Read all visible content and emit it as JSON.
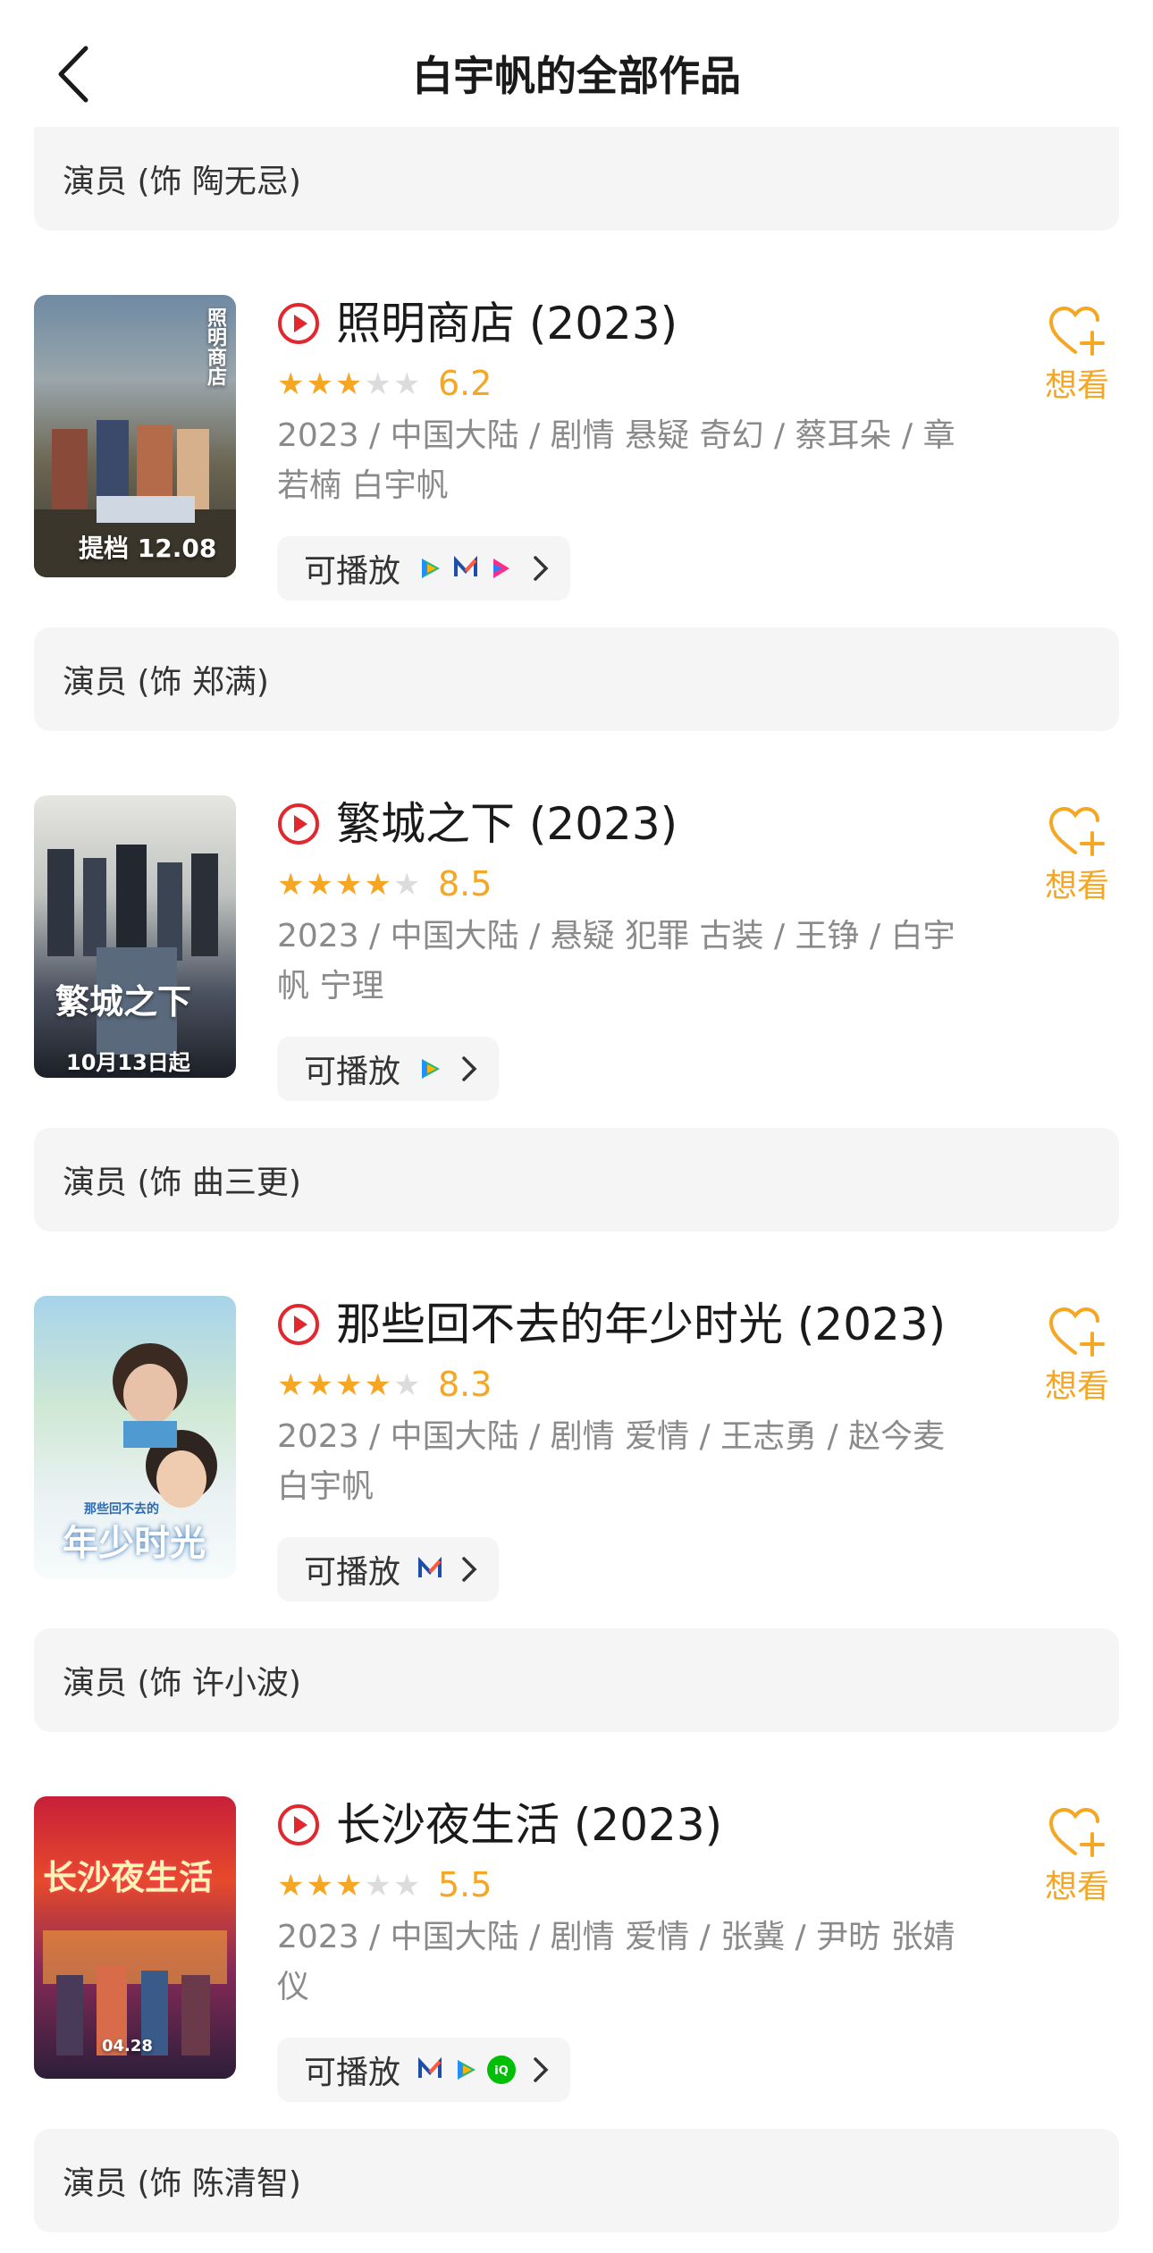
{
  "header": {
    "title": "白宇帆的全部作品"
  },
  "roles": [
    "演员 (饰 陶无忌)",
    "演员 (饰 郑满)",
    "演员 (饰 曲三更)",
    "演员 (饰 许小波)",
    "演员 (饰 陈清智)"
  ],
  "works": [
    {
      "title": "照明商店 (2023)",
      "rating": "6.2",
      "stars": 3,
      "meta": "2023 / 中国大陆 / 剧情 悬疑 奇幻 / 蔡耳朵 / 章若楠 白宇帆",
      "play_label": "可播放",
      "platforms": [
        "tencent-video-icon",
        "mgtv-icon",
        "youku-icon"
      ],
      "want_label": "想看",
      "poster_text": [
        "照明商店",
        "提档 12.08"
      ]
    },
    {
      "title": "繁城之下 (2023)",
      "rating": "8.5",
      "stars": 4,
      "meta": "2023 / 中国大陆 / 悬疑 犯罪 古装 / 王铮 / 白宇帆 宁理",
      "play_label": "可播放",
      "platforms": [
        "tencent-video-icon"
      ],
      "want_label": "想看",
      "poster_text": [
        "繁城之下",
        "10月13日起"
      ]
    },
    {
      "title": "那些回不去的年少时光 (2023)",
      "rating": "8.3",
      "stars": 4,
      "meta": "2023 / 中国大陆 / 剧情 爱情 / 王志勇 / 赵今麦 白宇帆",
      "play_label": "可播放",
      "platforms": [
        "mgtv-icon"
      ],
      "want_label": "想看",
      "poster_text": [
        "那些回不去的",
        "年少时光"
      ]
    },
    {
      "title": "长沙夜生活 (2023)",
      "rating": "5.5",
      "stars": 3,
      "meta": "2023 / 中国大陆 / 剧情 爱情 / 张冀 / 尹昉 张婧仪",
      "play_label": "可播放",
      "platforms": [
        "mgtv-icon",
        "tencent-video-icon",
        "iqiyi-icon"
      ],
      "want_label": "想看",
      "poster_text": [
        "长沙夜生活",
        "04.28"
      ]
    }
  ],
  "colors": {
    "accent": "#f5a623",
    "play_red": "#e0282e",
    "meta_gray": "#8a8a8a",
    "panel": "#f5f5f5"
  }
}
